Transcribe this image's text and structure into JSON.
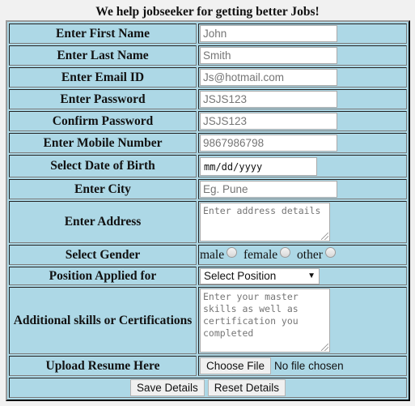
{
  "page": {
    "title": "We help jobseeker for getting better Jobs!"
  },
  "form": {
    "first_name": {
      "label": "Enter First Name",
      "placeholder": "John"
    },
    "last_name": {
      "label": "Enter Last Name",
      "placeholder": "Smith"
    },
    "email": {
      "label": "Enter Email ID",
      "placeholder": "Js@hotmail.com"
    },
    "password": {
      "label": "Enter Password",
      "placeholder": "JSJS123"
    },
    "confirm_password": {
      "label": "Confirm Password",
      "placeholder": "JSJS123"
    },
    "mobile": {
      "label": "Enter Mobile Number",
      "placeholder": "9867986798"
    },
    "dob": {
      "label": "Select Date of Birth",
      "placeholder": "mm/dd/yyyy"
    },
    "city": {
      "label": "Enter City",
      "placeholder": "Eg. Pune"
    },
    "address": {
      "label": "Enter Address",
      "placeholder": "Enter address details"
    },
    "gender": {
      "label": "Select Gender",
      "options": [
        "male",
        "female",
        "other"
      ]
    },
    "position": {
      "label": "Position Applied for",
      "selected": "Select Position",
      "arrow_icon": "▼"
    },
    "skills": {
      "label": "Additional skills or Certifications",
      "placeholder": "Enter your master skills as well as certification you completed"
    },
    "resume": {
      "label": "Upload Resume Here",
      "button": "Choose File",
      "status": "No file chosen"
    },
    "actions": {
      "save": "Save Details",
      "reset": "Reset Details"
    }
  }
}
